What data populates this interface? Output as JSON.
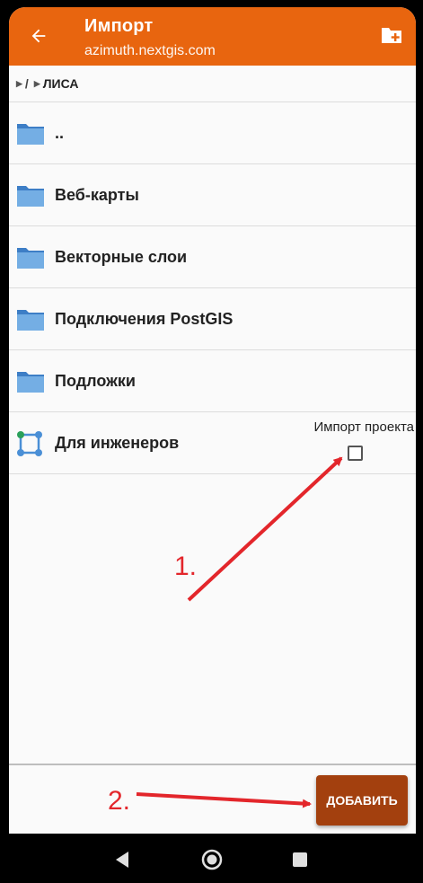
{
  "appbar": {
    "title": "Импорт",
    "subtitle": "azimuth.nextgis.com",
    "back_icon": "arrow-left-icon",
    "action_icon": "create-folder-icon",
    "color": "#e8650f"
  },
  "breadcrumb": {
    "root": "/",
    "current": "ЛИСА"
  },
  "items": [
    {
      "label": "..",
      "icon": "folder-icon"
    },
    {
      "label": "Веб-карты",
      "icon": "folder-icon"
    },
    {
      "label": "Векторные слои",
      "icon": "folder-icon"
    },
    {
      "label": "Подключения PostGIS",
      "icon": "folder-icon"
    },
    {
      "label": "Подложки",
      "icon": "folder-icon"
    },
    {
      "label": "Для инженеров",
      "icon": "project-icon",
      "import_label": "Импорт проекта",
      "checked": false
    }
  ],
  "actions": {
    "add_label": "ДОБАВИТЬ",
    "add_color": "#a3400e"
  },
  "annotations": {
    "step1": "1.",
    "step2": "2.",
    "color": "#e3262b"
  }
}
